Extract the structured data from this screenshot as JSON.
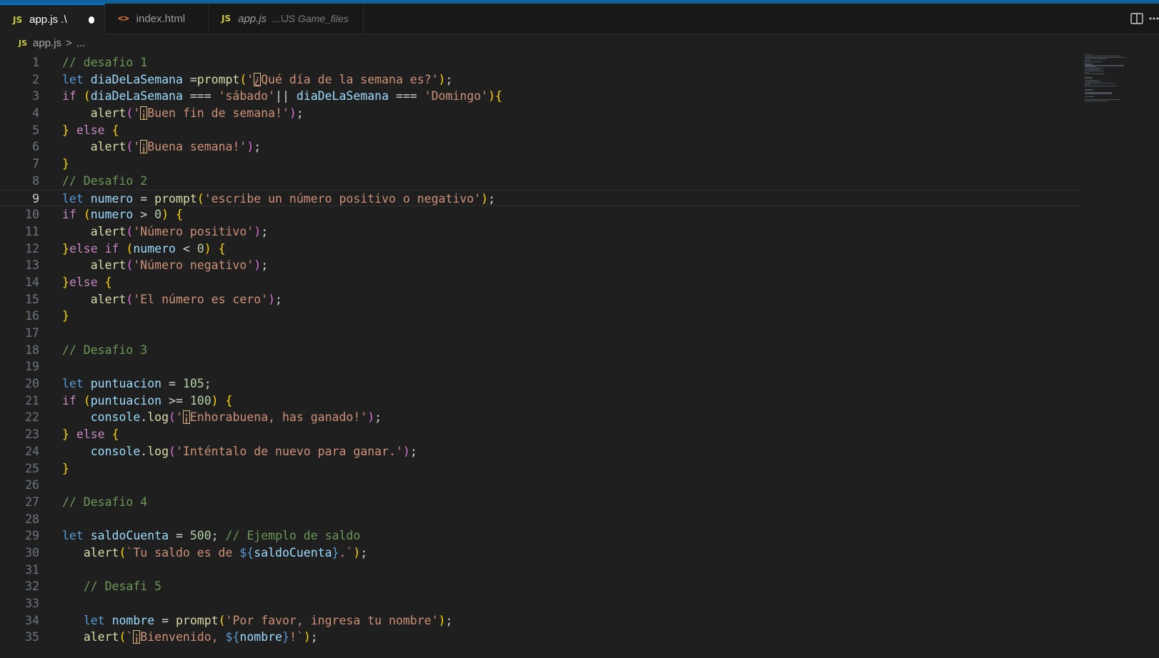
{
  "tabs": [
    {
      "label": "app.js .\\",
      "badge": "JS",
      "active": true,
      "dirty": true
    },
    {
      "label": "index.html",
      "badge": "<>",
      "active": false
    },
    {
      "label": "app.js",
      "badge": "JS",
      "description": "...\\JS Game_files",
      "active": false
    }
  ],
  "breadcrumb": {
    "badge": "JS",
    "file": "app.js",
    "separator": ">",
    "rest": "..."
  },
  "current_line": 9,
  "lines": [
    {
      "n": 1,
      "tokens": [
        [
          "// desafio 1",
          "com"
        ]
      ]
    },
    {
      "n": 2,
      "tokens": [
        [
          "let",
          "kw"
        ],
        [
          " ",
          "pl"
        ],
        [
          "diaDeLaSemana",
          "var"
        ],
        [
          " =",
          "op"
        ],
        [
          "prompt",
          "fn"
        ],
        [
          "(",
          "br1"
        ],
        [
          "'",
          "str"
        ],
        [
          "¿",
          "hl-str"
        ],
        [
          "Qué día",
          "str"
        ],
        [
          " de la semana es?'",
          "str"
        ],
        [
          ")",
          "br1"
        ],
        [
          ";",
          "pl"
        ]
      ]
    },
    {
      "n": 3,
      "tokens": [
        [
          "if",
          "ctrl"
        ],
        [
          " ",
          "pl"
        ],
        [
          "(",
          "br1"
        ],
        [
          "diaDeLaSemana",
          "var"
        ],
        [
          " === ",
          "op"
        ],
        [
          "'sábado'",
          "str"
        ],
        [
          "|| ",
          "op"
        ],
        [
          "diaDeLaSemana",
          "var"
        ],
        [
          " === ",
          "op"
        ],
        [
          "'Domingo'",
          "str"
        ],
        [
          ")",
          "br1"
        ],
        [
          "{",
          "br1"
        ]
      ]
    },
    {
      "n": 4,
      "tokens": [
        [
          "    ",
          "pl"
        ],
        [
          "alert",
          "fn"
        ],
        [
          "(",
          "br2"
        ],
        [
          "'",
          "str"
        ],
        [
          "¡",
          "hl-str"
        ],
        [
          "Buen fin de semana!'",
          "str"
        ],
        [
          ")",
          "br2"
        ],
        [
          ";",
          "pl"
        ]
      ]
    },
    {
      "n": 5,
      "tokens": [
        [
          "}",
          "br1"
        ],
        [
          " ",
          "pl"
        ],
        [
          "else",
          "ctrl"
        ],
        [
          " ",
          "pl"
        ],
        [
          "{",
          "br1"
        ]
      ]
    },
    {
      "n": 6,
      "tokens": [
        [
          "    ",
          "pl"
        ],
        [
          "alert",
          "fn"
        ],
        [
          "(",
          "br2"
        ],
        [
          "'",
          "str"
        ],
        [
          "¡",
          "hl-str"
        ],
        [
          "Buena semana!'",
          "str"
        ],
        [
          ")",
          "br2"
        ],
        [
          ";",
          "pl"
        ]
      ]
    },
    {
      "n": 7,
      "tokens": [
        [
          "}",
          "br1"
        ]
      ]
    },
    {
      "n": 8,
      "tokens": [
        [
          "// Desafio 2",
          "com"
        ]
      ]
    },
    {
      "n": 9,
      "tokens": [
        [
          "let",
          "kw"
        ],
        [
          " ",
          "pl"
        ],
        [
          "numero",
          "var"
        ],
        [
          " = ",
          "op"
        ],
        [
          "prompt",
          "fn"
        ],
        [
          "(",
          "br1"
        ],
        [
          "'escribe un número positivo o negativo'",
          "str"
        ],
        [
          ")",
          "br1"
        ],
        [
          ";",
          "pl"
        ]
      ]
    },
    {
      "n": 10,
      "tokens": [
        [
          "if",
          "ctrl"
        ],
        [
          " ",
          "pl"
        ],
        [
          "(",
          "br1"
        ],
        [
          "numero",
          "var"
        ],
        [
          " > ",
          "op"
        ],
        [
          "0",
          "num"
        ],
        [
          ")",
          "br1"
        ],
        [
          " ",
          "pl"
        ],
        [
          "{",
          "br1"
        ]
      ]
    },
    {
      "n": 11,
      "tokens": [
        [
          "    ",
          "pl"
        ],
        [
          "alert",
          "fn"
        ],
        [
          "(",
          "br2"
        ],
        [
          "'Número positivo'",
          "str"
        ],
        [
          ")",
          "br2"
        ],
        [
          ";",
          "pl"
        ]
      ]
    },
    {
      "n": 12,
      "tokens": [
        [
          "}",
          "br1"
        ],
        [
          "else if",
          "ctrl"
        ],
        [
          " ",
          "pl"
        ],
        [
          "(",
          "br1"
        ],
        [
          "numero",
          "var"
        ],
        [
          " < ",
          "op"
        ],
        [
          "0",
          "num"
        ],
        [
          ")",
          "br1"
        ],
        [
          " ",
          "pl"
        ],
        [
          "{",
          "br1"
        ]
      ]
    },
    {
      "n": 13,
      "tokens": [
        [
          "    ",
          "pl"
        ],
        [
          "alert",
          "fn"
        ],
        [
          "(",
          "br2"
        ],
        [
          "'Número negativo'",
          "str"
        ],
        [
          ")",
          "br2"
        ],
        [
          ";",
          "pl"
        ]
      ]
    },
    {
      "n": 14,
      "tokens": [
        [
          "}",
          "br1"
        ],
        [
          "else",
          "ctrl"
        ],
        [
          " ",
          "pl"
        ],
        [
          "{",
          "br1"
        ]
      ]
    },
    {
      "n": 15,
      "tokens": [
        [
          "    ",
          "pl"
        ],
        [
          "alert",
          "fn"
        ],
        [
          "(",
          "br2"
        ],
        [
          "'El número es cero'",
          "str"
        ],
        [
          ")",
          "br2"
        ],
        [
          ";",
          "pl"
        ]
      ]
    },
    {
      "n": 16,
      "tokens": [
        [
          "}",
          "br1"
        ]
      ]
    },
    {
      "n": 17,
      "tokens": []
    },
    {
      "n": 18,
      "tokens": [
        [
          "// Desafio 3",
          "com"
        ]
      ]
    },
    {
      "n": 19,
      "tokens": []
    },
    {
      "n": 20,
      "tokens": [
        [
          "let",
          "kw"
        ],
        [
          " ",
          "pl"
        ],
        [
          "puntuacion",
          "var"
        ],
        [
          " = ",
          "op"
        ],
        [
          "105",
          "num"
        ],
        [
          ";",
          "pl"
        ]
      ]
    },
    {
      "n": 21,
      "tokens": [
        [
          "if",
          "ctrl"
        ],
        [
          " ",
          "pl"
        ],
        [
          "(",
          "br1"
        ],
        [
          "puntuacion",
          "var"
        ],
        [
          " >= ",
          "op"
        ],
        [
          "100",
          "num"
        ],
        [
          ")",
          "br1"
        ],
        [
          " ",
          "pl"
        ],
        [
          "{",
          "br1"
        ]
      ]
    },
    {
      "n": 22,
      "tokens": [
        [
          "    ",
          "pl"
        ],
        [
          "console",
          "var"
        ],
        [
          ".",
          "pl"
        ],
        [
          "log",
          "fn"
        ],
        [
          "(",
          "br2"
        ],
        [
          "'",
          "str"
        ],
        [
          "¡",
          "hl-str"
        ],
        [
          "Enhorabuena, has ganado!'",
          "str"
        ],
        [
          ")",
          "br2"
        ],
        [
          ";",
          "pl"
        ]
      ]
    },
    {
      "n": 23,
      "tokens": [
        [
          "}",
          "br1"
        ],
        [
          " ",
          "pl"
        ],
        [
          "else",
          "ctrl"
        ],
        [
          " ",
          "pl"
        ],
        [
          "{",
          "br1"
        ]
      ]
    },
    {
      "n": 24,
      "tokens": [
        [
          "    ",
          "pl"
        ],
        [
          "console",
          "var"
        ],
        [
          ".",
          "pl"
        ],
        [
          "log",
          "fn"
        ],
        [
          "(",
          "br2"
        ],
        [
          "'Inténtalo de nuevo para ganar.'",
          "str"
        ],
        [
          ")",
          "br2"
        ],
        [
          ";",
          "pl"
        ]
      ]
    },
    {
      "n": 25,
      "tokens": [
        [
          "}",
          "br1"
        ]
      ]
    },
    {
      "n": 26,
      "tokens": []
    },
    {
      "n": 27,
      "tokens": [
        [
          "// Desafio 4",
          "com"
        ]
      ]
    },
    {
      "n": 28,
      "tokens": []
    },
    {
      "n": 29,
      "tokens": [
        [
          "let",
          "kw"
        ],
        [
          " ",
          "pl"
        ],
        [
          "saldoCuenta",
          "var"
        ],
        [
          " = ",
          "op"
        ],
        [
          "500",
          "num"
        ],
        [
          "; ",
          "pl"
        ],
        [
          "// Ejemplo de saldo",
          "com"
        ]
      ]
    },
    {
      "n": 30,
      "tokens": [
        [
          "   ",
          "pl"
        ],
        [
          "alert",
          "fn"
        ],
        [
          "(",
          "br1"
        ],
        [
          "`Tu saldo es de ",
          "str"
        ],
        [
          "${",
          "tpl"
        ],
        [
          "saldoCuenta",
          "var"
        ],
        [
          "}",
          "tpl"
        ],
        [
          ".`",
          "str"
        ],
        [
          ")",
          "br1"
        ],
        [
          ";",
          "pl"
        ]
      ]
    },
    {
      "n": 31,
      "tokens": []
    },
    {
      "n": 32,
      "tokens": [
        [
          "   ",
          "pl"
        ],
        [
          "// Desafi 5",
          "com"
        ]
      ]
    },
    {
      "n": 33,
      "tokens": []
    },
    {
      "n": 34,
      "tokens": [
        [
          "   ",
          "pl"
        ],
        [
          "let",
          "kw"
        ],
        [
          " ",
          "pl"
        ],
        [
          "nombre",
          "var"
        ],
        [
          " = ",
          "op"
        ],
        [
          "prompt",
          "fn"
        ],
        [
          "(",
          "br1"
        ],
        [
          "'Por favor, ingresa tu nombre'",
          "str"
        ],
        [
          ")",
          "br1"
        ],
        [
          ";",
          "pl"
        ]
      ]
    },
    {
      "n": 35,
      "tokens": [
        [
          "   ",
          "pl"
        ],
        [
          "alert",
          "fn"
        ],
        [
          "(",
          "br1"
        ],
        [
          "`",
          "str"
        ],
        [
          "¡",
          "hl-str"
        ],
        [
          "Bienvenido, ",
          "str"
        ],
        [
          "${",
          "tpl"
        ],
        [
          "nombre",
          "var"
        ],
        [
          "}",
          "tpl"
        ],
        [
          "!`",
          "str"
        ],
        [
          ")",
          "br1"
        ],
        [
          ";",
          "pl"
        ]
      ]
    }
  ]
}
